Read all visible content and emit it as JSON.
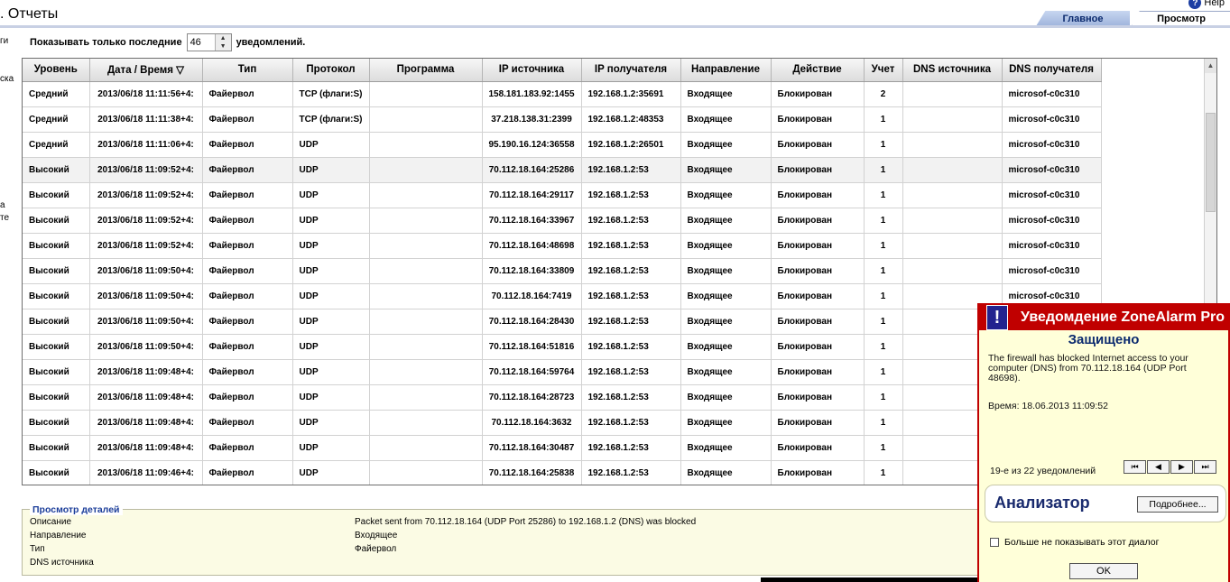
{
  "header": {
    "title": ". Отчеты",
    "help": "Help",
    "tabs": [
      "Главное",
      "Просмотр"
    ]
  },
  "sidebar_fragments": [
    "ги",
    "ска",
    "а",
    "те"
  ],
  "filter": {
    "label_before": "Показывать только последние",
    "value": "46",
    "label_after": "уведомлений."
  },
  "table": {
    "columns": [
      "Уровень",
      "Дата / Время ▽",
      "Тип",
      "Протокол",
      "Программа",
      "IP источника",
      "IP получателя",
      "Направление",
      "Действие",
      "Учет",
      "DNS источника",
      "DNS получателя"
    ],
    "rows": [
      [
        "Средний",
        "2013/06/18 11:11:56+4:",
        "Файервол",
        "TCP (флаги:S)",
        "",
        "158.181.183.92:1455",
        "192.168.1.2:35691",
        "Входящее",
        "Блокирован",
        "2",
        "",
        "microsof-c0c310"
      ],
      [
        "Средний",
        "2013/06/18 11:11:38+4:",
        "Файервол",
        "TCP (флаги:S)",
        "",
        "37.218.138.31:2399",
        "192.168.1.2:48353",
        "Входящее",
        "Блокирован",
        "1",
        "",
        "microsof-c0c310"
      ],
      [
        "Средний",
        "2013/06/18 11:11:06+4:",
        "Файервол",
        "UDP",
        "",
        "95.190.16.124:36558",
        "192.168.1.2:26501",
        "Входящее",
        "Блокирован",
        "1",
        "",
        "microsof-c0c310"
      ],
      [
        "Высокий",
        "2013/06/18 11:09:52+4:",
        "Файервол",
        "UDP",
        "",
        "70.112.18.164:25286",
        "192.168.1.2:53",
        "Входящее",
        "Блокирован",
        "1",
        "",
        "microsof-c0c310"
      ],
      [
        "Высокий",
        "2013/06/18 11:09:52+4:",
        "Файервол",
        "UDP",
        "",
        "70.112.18.164:29117",
        "192.168.1.2:53",
        "Входящее",
        "Блокирован",
        "1",
        "",
        "microsof-c0c310"
      ],
      [
        "Высокий",
        "2013/06/18 11:09:52+4:",
        "Файервол",
        "UDP",
        "",
        "70.112.18.164:33967",
        "192.168.1.2:53",
        "Входящее",
        "Блокирован",
        "1",
        "",
        "microsof-c0c310"
      ],
      [
        "Высокий",
        "2013/06/18 11:09:52+4:",
        "Файервол",
        "UDP",
        "",
        "70.112.18.164:48698",
        "192.168.1.2:53",
        "Входящее",
        "Блокирован",
        "1",
        "",
        "microsof-c0c310"
      ],
      [
        "Высокий",
        "2013/06/18 11:09:50+4:",
        "Файервол",
        "UDP",
        "",
        "70.112.18.164:33809",
        "192.168.1.2:53",
        "Входящее",
        "Блокирован",
        "1",
        "",
        "microsof-c0c310"
      ],
      [
        "Высокий",
        "2013/06/18 11:09:50+4:",
        "Файервол",
        "UDP",
        "",
        "70.112.18.164:7419",
        "192.168.1.2:53",
        "Входящее",
        "Блокирован",
        "1",
        "",
        "microsof-c0c310"
      ],
      [
        "Высокий",
        "2013/06/18 11:09:50+4:",
        "Файервол",
        "UDP",
        "",
        "70.112.18.164:28430",
        "192.168.1.2:53",
        "Входящее",
        "Блокирован",
        "1",
        "",
        ""
      ],
      [
        "Высокий",
        "2013/06/18 11:09:50+4:",
        "Файервол",
        "UDP",
        "",
        "70.112.18.164:51816",
        "192.168.1.2:53",
        "Входящее",
        "Блокирован",
        "1",
        "",
        ""
      ],
      [
        "Высокий",
        "2013/06/18 11:09:48+4:",
        "Файервол",
        "UDP",
        "",
        "70.112.18.164:59764",
        "192.168.1.2:53",
        "Входящее",
        "Блокирован",
        "1",
        "",
        ""
      ],
      [
        "Высокий",
        "2013/06/18 11:09:48+4:",
        "Файервол",
        "UDP",
        "",
        "70.112.18.164:28723",
        "192.168.1.2:53",
        "Входящее",
        "Блокирован",
        "1",
        "",
        ""
      ],
      [
        "Высокий",
        "2013/06/18 11:09:48+4:",
        "Файервол",
        "UDP",
        "",
        "70.112.18.164:3632",
        "192.168.1.2:53",
        "Входящее",
        "Блокирован",
        "1",
        "",
        ""
      ],
      [
        "Высокий",
        "2013/06/18 11:09:48+4:",
        "Файервол",
        "UDP",
        "",
        "70.112.18.164:30487",
        "192.168.1.2:53",
        "Входящее",
        "Блокирован",
        "1",
        "",
        ""
      ],
      [
        "Высокий",
        "2013/06/18 11:09:46+4:",
        "Файервол",
        "UDP",
        "",
        "70.112.18.164:25838",
        "192.168.1.2:53",
        "Входящее",
        "Блокирован",
        "1",
        "",
        ""
      ]
    ]
  },
  "details": {
    "title": "Просмотр деталей",
    "labels": [
      "Описание",
      "Направление",
      "Тип",
      "DNS источника"
    ],
    "values": [
      "Packet sent from 70.112.18.164 (UDP Port 25286) to 192.168.1.2 (DNS) was blocked",
      "Входящее",
      "Файервол",
      ""
    ]
  },
  "popup": {
    "title": "Уведомдение ZoneAlarm Pro",
    "status": "Защищено",
    "message": "The firewall has blocked Internet access to your computer (DNS) from 70.112.18.164 (UDP Port 48698).",
    "time": "Время: 18.06.2013 11:09:52",
    "counter": "19-е из 22 уведомлений",
    "nav": [
      "⏮",
      "◀",
      "▶",
      "⏭"
    ],
    "analyzer": "Анализатор",
    "more": "Подробнее...",
    "checkbox": "Больше не показывать этот диалог",
    "ok": "OK"
  },
  "colors": {
    "accent": "#c00000",
    "tab": "#9fb4dc",
    "details_bg": "#fbfbe4",
    "popup_bg": "#ffffd9"
  }
}
